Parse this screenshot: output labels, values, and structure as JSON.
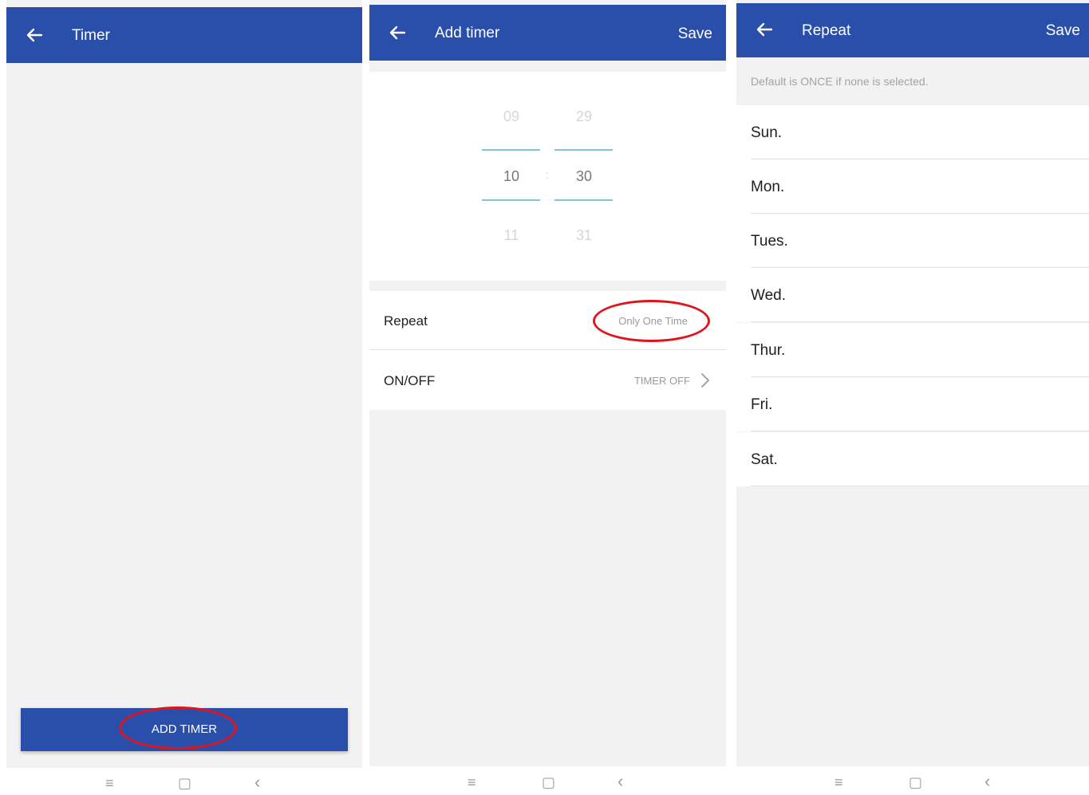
{
  "screen1": {
    "title": "Timer",
    "add_timer_label": "ADD TIMER"
  },
  "screen2": {
    "title": "Add timer",
    "save_label": "Save",
    "picker": {
      "hours": [
        "09",
        "10",
        "11"
      ],
      "minutes": [
        "29",
        "30",
        "31"
      ],
      "separator": ":"
    },
    "repeat_label": "Repeat",
    "repeat_value": "Only One Time",
    "onoff_label": "ON/OFF",
    "onoff_value": "TIMER OFF"
  },
  "screen3": {
    "title": "Repeat",
    "save_label": "Save",
    "hint": "Default is ONCE if none is selected.",
    "days": [
      "Sun.",
      "Mon.",
      "Tues.",
      "Wed.",
      "Thur.",
      "Fri.",
      "Sat."
    ]
  },
  "nav": {
    "menu_glyph": "≡",
    "home_glyph": "▢",
    "back_glyph": "‹"
  },
  "colors": {
    "app_bar": "#2a4fab",
    "highlight_ring": "#e0141c",
    "picker_line": "#7ec6de"
  },
  "icons": [
    "back-arrow-icon",
    "chevron-right-icon",
    "menu-icon",
    "home-icon",
    "nav-back-icon"
  ]
}
